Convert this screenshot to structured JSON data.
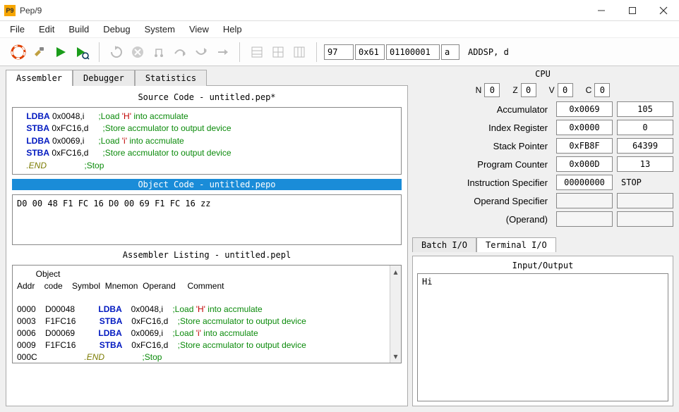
{
  "window": {
    "title": "Pep/9",
    "icon_text": "P9"
  },
  "menu": [
    "File",
    "Edit",
    "Build",
    "Debug",
    "System",
    "View",
    "Help"
  ],
  "toolbar_status": {
    "dec": "97",
    "hex": "0x61",
    "bin": "01100001",
    "char": "a",
    "instr": "ADDSP, d"
  },
  "tabs": {
    "assembler": "Assembler",
    "debugger": "Debugger",
    "statistics": "Statistics"
  },
  "source": {
    "title": "Source Code - untitled.pep*",
    "lines": [
      {
        "mn": "LDBA",
        "args": "0x0048,i",
        "cm": ";Load ",
        "str": "'H'",
        "cm2": " into accmulate"
      },
      {
        "mn": "STBA",
        "args": "0xFC16,d",
        "cm": ";Store accmulator to output device",
        "str": "",
        "cm2": ""
      },
      {
        "mn": "LDBA",
        "args": "0x0069,i",
        "cm": ";Load ",
        "str": "'i'",
        "cm2": " into accmulate"
      },
      {
        "mn": "STBA",
        "args": "0xFC16,d",
        "cm": ";Store accmulator to output device",
        "str": "",
        "cm2": ""
      },
      {
        "mn": ".END",
        "args": "",
        "cm": ";Stop",
        "str": "",
        "cm2": ""
      }
    ]
  },
  "object": {
    "title": "Object Code - untitled.pepo",
    "text": "D0 00 48 F1 FC 16 D0 00 69 F1 FC 16 zz"
  },
  "listing": {
    "title": "Assembler Listing - untitled.pepl",
    "header1": "        Object",
    "header2": "Addr    code    Symbol  Mnemon  Operand     Comment",
    "rows": [
      {
        "addr": "0000",
        "obj": "D00048",
        "sym": "",
        "mn": "LDBA",
        "op": "0x0048,i",
        "cm": ";Load ",
        "str": "'H'",
        "cm2": " into accmulate"
      },
      {
        "addr": "0003",
        "obj": "F1FC16",
        "sym": "",
        "mn": "STBA",
        "op": "0xFC16,d",
        "cm": ";Store accmulator to output device",
        "str": "",
        "cm2": ""
      },
      {
        "addr": "0006",
        "obj": "D00069",
        "sym": "",
        "mn": "LDBA",
        "op": "0x0069,i",
        "cm": ";Load ",
        "str": "'i'",
        "cm2": " into accmulate"
      },
      {
        "addr": "0009",
        "obj": "F1FC16",
        "sym": "",
        "mn": "STBA",
        "op": "0xFC16,d",
        "cm": ";Store accmulator to output device",
        "str": "",
        "cm2": ""
      },
      {
        "addr": "000C",
        "obj": "",
        "sym": "",
        "mn": ".END",
        "op": "",
        "cm": ";Stop",
        "str": "",
        "cm2": ""
      }
    ]
  },
  "cpu": {
    "title": "CPU",
    "flags": {
      "N": "0",
      "Z": "0",
      "V": "0",
      "C": "0"
    },
    "regs": {
      "accumulator": {
        "label": "Accumulator",
        "hex": "0x0069",
        "dec": "105"
      },
      "index": {
        "label": "Index Register",
        "hex": "0x0000",
        "dec": "0"
      },
      "sp": {
        "label": "Stack Pointer",
        "hex": "0xFB8F",
        "dec": "64399"
      },
      "pc": {
        "label": "Program Counter",
        "hex": "0x000D",
        "dec": "13"
      },
      "ispec": {
        "label": "Instruction Specifier",
        "hex": "00000000",
        "dec": "STOP"
      },
      "ospec": {
        "label": "Operand Specifier",
        "hex": "",
        "dec": ""
      },
      "operand": {
        "label": "(Operand)",
        "hex": "",
        "dec": ""
      }
    }
  },
  "io": {
    "tab_batch": "Batch I/O",
    "tab_terminal": "Terminal I/O",
    "title": "Input/Output",
    "content": "Hi"
  }
}
